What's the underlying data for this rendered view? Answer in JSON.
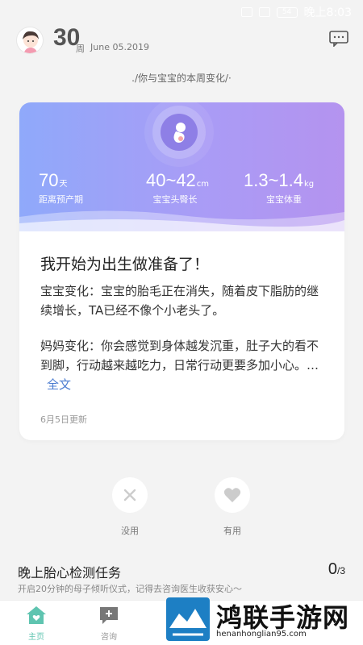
{
  "status_bar": {
    "time": "晚上8:03",
    "battery": "54"
  },
  "header": {
    "week_number": "30",
    "week_unit": "周",
    "date": "June  05.2019"
  },
  "subtitle": "./你与宝宝的本周变化/·",
  "card": {
    "stats": [
      {
        "value": "70",
        "unit": "天",
        "label": "距离预产期"
      },
      {
        "value": "40~42",
        "unit": "cm",
        "label": "宝宝头臀长"
      },
      {
        "value": "1.3~1.4",
        "unit": "kg",
        "label": "宝宝体重"
      }
    ],
    "title": "我开始为出生做准备了！",
    "baby_change": "宝宝变化：宝宝的胎毛正在消失，随着皮下脂肪的继续增长，TA已经不像个小老头了。",
    "mom_change": "妈妈变化：你会感觉到身体越发沉重，肚子大的看不到脚，行动越来越吃力，日常行动更要多加小心。…",
    "full_text_link": "全文",
    "updated": "6月5日更新"
  },
  "vote": {
    "useless_label": "没用",
    "useful_label": "有用"
  },
  "task": {
    "title": "晚上胎心检测任务",
    "desc": "开启20分钟的母子倾听仪式，记得去咨询医生收获安心～",
    "count": "0",
    "total": "/3"
  },
  "bottom_nav": {
    "home_label": "主页",
    "consult_label": "咨询"
  },
  "watermark": {
    "text": "鸿联手游网",
    "url": "henanhonglian95.com"
  },
  "colors": {
    "accent": "#5fc4b0",
    "banner_start": "#8fa9fa",
    "banner_end": "#b493ef",
    "link": "#4a7bd0"
  }
}
